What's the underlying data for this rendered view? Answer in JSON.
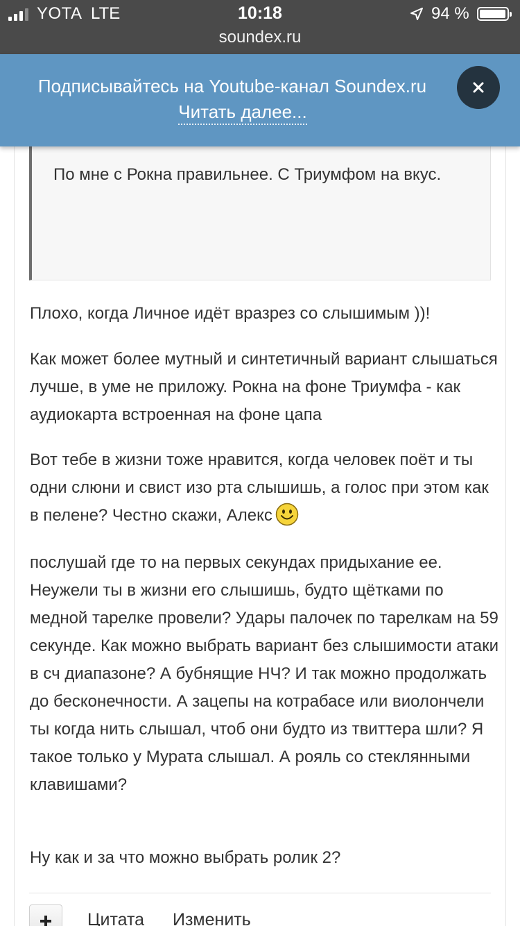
{
  "status_bar": {
    "carrier": "YOTA",
    "network": "LTE",
    "time": "10:18",
    "battery_percent": "94 %",
    "battery_level": 0.94
  },
  "browser": {
    "url": "soundex.ru"
  },
  "banner": {
    "text": "Подписывайтесь на Youtube-канал Soundex.ru",
    "link": "Читать далее...",
    "close_label": "×",
    "background": "#5f96c2"
  },
  "post": {
    "quote": "По мне с Рокна правильнее. С Триумфом на вкус.",
    "paragraphs": [
      "Плохо, когда Личное идёт вразрез со слышимым ))!",
      "Как может более мутный и синтетичный вариант слышаться лучше, в уме не приложу. Рокна на фоне Триумфа - как аудиокарта встроенная на фоне цапа",
      "Вот тебе в жизни тоже нравится, когда человек поёт и ты одни слюни и свист изо рта слышишь, а голос при этом как в пелене? Честно скажи, Алекс",
      "послушай где то на первых секундах придыхание ее. Неужели ты в жизни его слышишь, будто щётками по медной тарелке провели? Удары палочек по тарелкам на 59 секунде. Как можно выбрать вариант без слышимости атаки в сч диапазоне? А бубнящие НЧ? И так можно продолжать до бесконечности. А зацепы на котрабасе или виолончели ты когда нить слышал, чтоб они будто из твиттера шли? Я такое только у Мурата слышал. А рояль со стеклянными клавишами?",
      "Ну как и за что можно выбрать ролик 2?"
    ],
    "actions": {
      "plus": "+",
      "quote": "Цитата",
      "edit": "Изменить"
    }
  }
}
